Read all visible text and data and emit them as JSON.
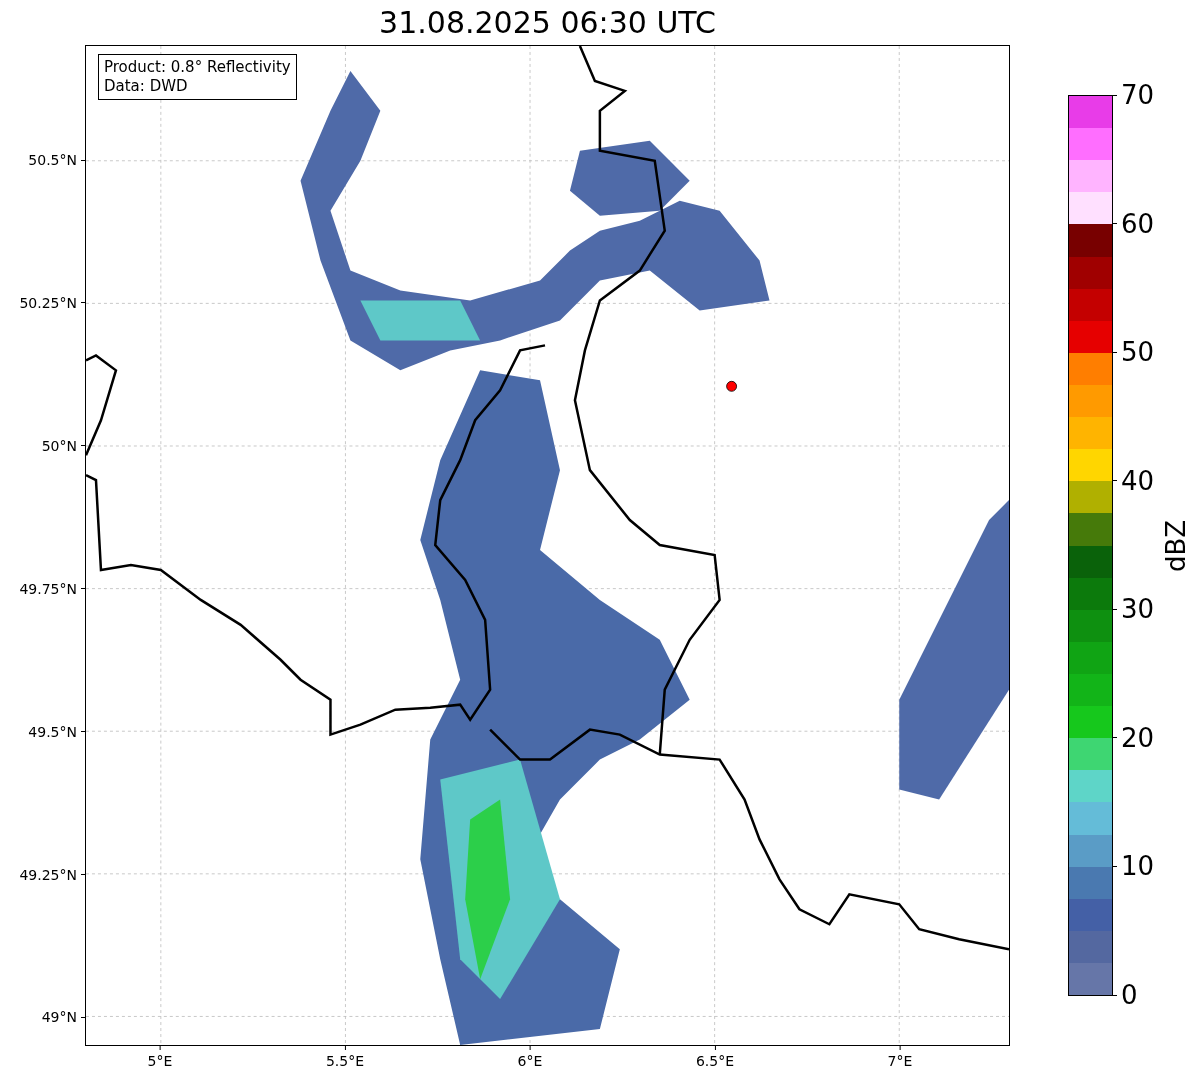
{
  "title": "31.08.2025 06:30 UTC",
  "info_box": {
    "lines": [
      "Product: 0.8° Reflectivity",
      "Data: DWD"
    ]
  },
  "y_ticks": [
    "50.5°N",
    "50.25°N",
    "50°N",
    "49.75°N",
    "49.5°N",
    "49.25°N",
    "49°N"
  ],
  "x_ticks": [
    "5°E",
    "5.5°E",
    "6°E",
    "6.5°E",
    "7°E"
  ],
  "colorbar": {
    "label": "dBZ",
    "ticks": [
      "70",
      "60",
      "50",
      "40",
      "30",
      "20",
      "10",
      "0"
    ],
    "segments": [
      {
        "color": "#e83ce8"
      },
      {
        "color": "#ff6eff"
      },
      {
        "color": "#ffb4ff"
      },
      {
        "color": "#ffe0ff"
      },
      {
        "color": "#780000"
      },
      {
        "color": "#a00000"
      },
      {
        "color": "#c40000"
      },
      {
        "color": "#e60000"
      },
      {
        "color": "#ff7e00"
      },
      {
        "color": "#ff9a00"
      },
      {
        "color": "#ffb400"
      },
      {
        "color": "#ffd600"
      },
      {
        "color": "#b0b000"
      },
      {
        "color": "#467a0a"
      },
      {
        "color": "#0a620a"
      },
      {
        "color": "#0c7a0c"
      },
      {
        "color": "#0e9010"
      },
      {
        "color": "#10a414"
      },
      {
        "color": "#12b418"
      },
      {
        "color": "#16c81c"
      },
      {
        "color": "#3ed672"
      },
      {
        "color": "#5ed5c8"
      },
      {
        "color": "#64bcd8"
      },
      {
        "color": "#5a9cc6"
      },
      {
        "color": "#4a79b0"
      },
      {
        "color": "#4460a6"
      },
      {
        "color": "#5468a0"
      },
      {
        "color": "#6676a8"
      }
    ]
  }
}
